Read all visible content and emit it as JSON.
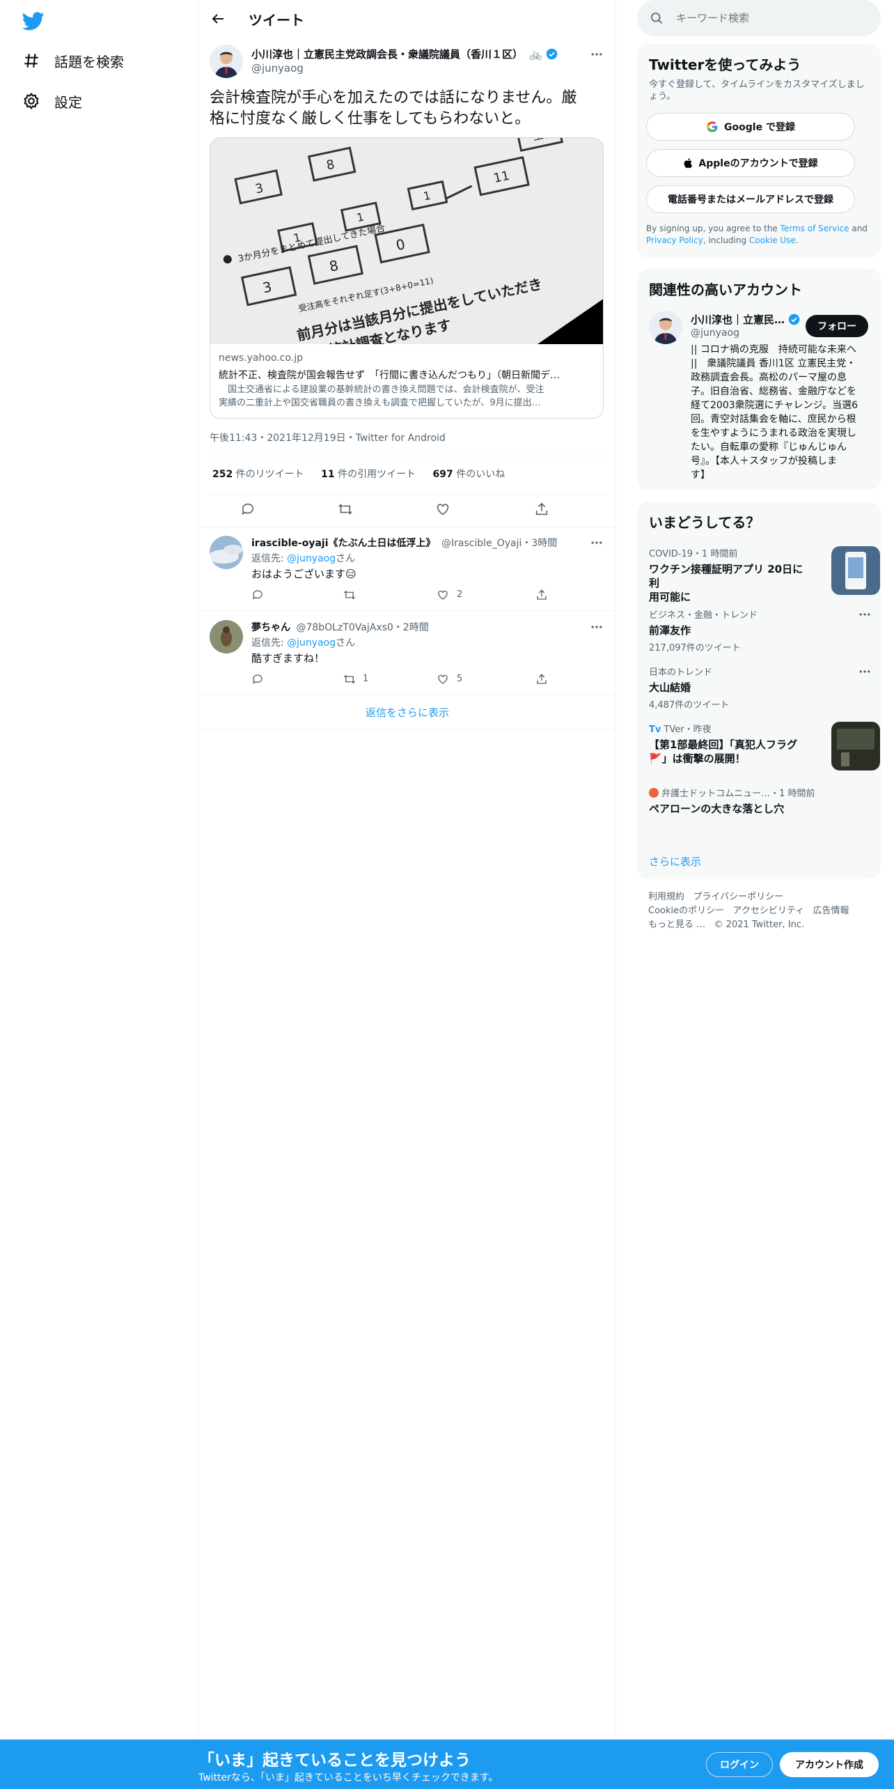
{
  "nav": {
    "explore_label": "話題を検索",
    "settings_label": "設定"
  },
  "header": {
    "title": "ツイート"
  },
  "tweet": {
    "author_name": "小川淳也｜立憲民主党政調会長・衆議院議員（香川１区）",
    "author_handle": "@junyaog",
    "text_line1": "会計検査院が手心を加えたのでは話になりません。厳",
    "text_line2": "格に忖度なく厳しく仕事をしてもらわないと。",
    "card": {
      "domain": "news.yahoo.co.jp",
      "title": "統計不正、検査院が国会報告せず　「行間に書き込んだつもり」（朝日新聞デ…",
      "desc_line1": "　国土交通省による建設業の基幹統計の書き換え問題では、会計検査院が、受注",
      "desc_line2": "実績の二重計上や国交省職員の書き換えも調査で把握していたが、9月に提出…",
      "image_text_a": "3か月分をまとめて提出してきた場合",
      "image_text_b": "受注高をそれぞれ足す(3+8+0=11)",
      "image_text_c": "前月分は当該月分に提出をしていただき",
      "image_text_d": "統計調査となります"
    },
    "meta": "午後11:43・2021年12月19日・Twitter for Android",
    "stats": {
      "retweets_count": "252",
      "retweets_label": " 件のリツイート",
      "quotes_count": "11",
      "quotes_label": " 件の引用ツイート",
      "likes_count": "697",
      "likes_label": " 件のいいね"
    }
  },
  "replies": [
    {
      "name": "irascible-oyaji《たぶん土日は低浮上》",
      "handle_time": "@Irascible_Oyaji・3時間",
      "reply_to_prefix": "返信先: ",
      "reply_to_handle": "@junyaog",
      "reply_to_suffix": "さん",
      "text": "おはようございます😑",
      "retweets": "",
      "likes": "2"
    },
    {
      "name": "夢ちゃん",
      "handle_time": "@78bOLzT0VajAxs0・2時間",
      "reply_to_prefix": "返信先: ",
      "reply_to_handle": "@junyaog",
      "reply_to_suffix": "さん",
      "text": "酷すぎますね！",
      "retweets": "1",
      "likes": "5"
    }
  ],
  "show_more_replies": "返信をさらに表示",
  "search": {
    "placeholder": "キーワード検索"
  },
  "signup": {
    "title": "Twitterを使ってみよう",
    "subtitle_line1": "今すぐ登録して、タイムラインをカスタマイズしまし",
    "subtitle_line2": "ょう。",
    "google": "Google で登録",
    "apple": "Appleのアカウントで登録",
    "phone": "電話番号またはメールアドレスで登録",
    "terms_a": "By signing up, you agree to the ",
    "terms_link": "Terms of Service",
    "terms_b": " and",
    "privacy_link": "Privacy Policy",
    "terms_c": ", including ",
    "cookie_link": "Cookie Use",
    "terms_d": "."
  },
  "related": {
    "title": "関連性の高いアカウント",
    "name": "小川淳也｜立憲民…",
    "handle": "@junyaog",
    "follow": "フォロー",
    "bio": [
      "|| コロナ禍の克服　持続可能な未来へ",
      "||　衆議院議員 香川1区 立憲民主党・",
      "政務調査会長。高松のパーマ屋の息",
      "子。旧自治省、総務省、金融庁などを",
      "経て2003衆院選にチャレンジ。当選6",
      "回。青空対話集会を軸に、庶民から根",
      "を生やすようにうまれる政治を実現し",
      "たい。自転車の愛称『じゅんじゅん",
      "号』。【本人＋スタッフが投稿しま",
      "す】"
    ]
  },
  "trends": {
    "title": "いまどうしてる？",
    "items": [
      {
        "context": "COVID-19・1 時間前",
        "title_line1": "ワクチン接種証明アプリ 20日に利",
        "title_line2": "用可能に",
        "count": ""
      },
      {
        "context": "ビジネス・金融・トレンド",
        "title_line1": "前澤友作",
        "title_line2": "",
        "count": "217,097件のツイート"
      },
      {
        "context": "日本のトレンド",
        "title_line1": "大山結婚",
        "title_line2": "",
        "count": "4,487件のツイート"
      },
      {
        "context": "TVer・昨夜",
        "title_line1": "【第1部最終回】「真犯人フラグ",
        "title_line2": "🚩」は衝撃の展開！",
        "count": ""
      },
      {
        "context": "弁護士ドットコムニュー…・1 時間前",
        "title_line1": "ペアローンの大きな落とし穴",
        "title_line2": "",
        "count": ""
      }
    ],
    "show_more": "さらに表示"
  },
  "footer_links": {
    "line1": [
      "利用規約",
      "プライバシーポリシー"
    ],
    "line2": [
      "Cookieのポリシー",
      "アクセシビリティ",
      "広告情報"
    ],
    "more": "もっと見る …",
    "copyright": "© 2021 Twitter, Inc."
  },
  "bottom_bar": {
    "title": "「いま」起きていることを見つけよう",
    "subtitle": "Twitterなら、「いま」起きていることをいち早くチェックできます。",
    "login": "ログイン",
    "signup": "アカウント作成"
  },
  "colors": {
    "accent": "#1d9bf0",
    "text": "#0f1419",
    "secondary": "#536471"
  }
}
